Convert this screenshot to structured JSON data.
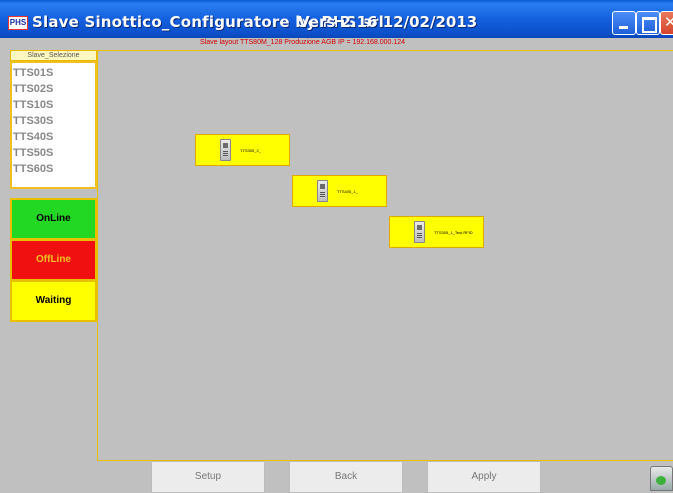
{
  "window": {
    "app_icon": "PHS",
    "title": "Slave Sinottico_Configuratore by PHS srl",
    "version": "Vers 2.16  12/02/2013",
    "controls": [
      "minimize-icon",
      "maximize-icon",
      "close-icon"
    ]
  },
  "status_line": "Slave layout   TTS80M_128   Produzione AGB   IP = 192.168.000.124",
  "left_panel": {
    "title": "Slave_Selezione",
    "items": [
      "TTS01S",
      "TTS02S",
      "TTS10S",
      "TTS30S",
      "TTS40S",
      "TTS50S",
      "TTS60S"
    ],
    "legend": {
      "online": "OnLine",
      "offline": "OffLine",
      "waiting": "Waiting"
    }
  },
  "canvas": {
    "nodes": [
      {
        "label": "TTS305_2_"
      },
      {
        "label": "TTS405_1_"
      },
      {
        "label": "TTS305_1_Test RFID"
      }
    ]
  },
  "buttons": {
    "setup": "Setup",
    "back": "Back",
    "apply": "Apply"
  },
  "colors": {
    "title_bar": "#1460df",
    "online": "#22d822",
    "offline": "#f01010",
    "waiting": "#ffff00",
    "node": "#ffff00",
    "status_text": "#d10000"
  },
  "icons": {
    "recycle_bin": "recycle-bin-icon",
    "device": "device-icon"
  }
}
